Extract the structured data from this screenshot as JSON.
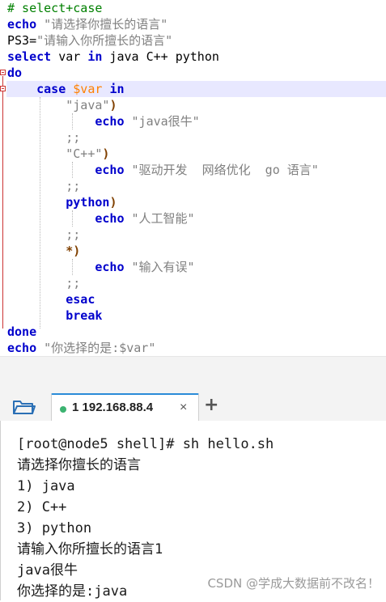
{
  "editor": {
    "lines": [
      [
        {
          "c": "cm",
          "t": "# select+case"
        }
      ],
      [
        {
          "c": "kw",
          "t": "echo"
        },
        {
          "c": "plain",
          "t": " "
        },
        {
          "c": "str",
          "t": "\"请选择你擅长的语言\""
        }
      ],
      [
        {
          "c": "plain",
          "t": "PS3="
        },
        {
          "c": "str",
          "t": "\"请输入你所擅长的语言\""
        }
      ],
      [
        {
          "c": "kw",
          "t": "select"
        },
        {
          "c": "plain",
          "t": " var "
        },
        {
          "c": "kw",
          "t": "in"
        },
        {
          "c": "plain",
          "t": " java C++ python"
        }
      ],
      [
        {
          "c": "kw",
          "t": "do"
        }
      ],
      [
        {
          "c": "plain",
          "t": "    "
        },
        {
          "c": "kw",
          "t": "case"
        },
        {
          "c": "plain",
          "t": " "
        },
        {
          "c": "var",
          "t": "$var"
        },
        {
          "c": "plain",
          "t": " "
        },
        {
          "c": "kw",
          "t": "in"
        }
      ],
      [
        {
          "c": "plain",
          "t": "        "
        },
        {
          "c": "str",
          "t": "\"java\""
        },
        {
          "c": "op",
          "t": ")"
        }
      ],
      [
        {
          "c": "plain",
          "t": "            "
        },
        {
          "c": "kw",
          "t": "echo"
        },
        {
          "c": "plain",
          "t": " "
        },
        {
          "c": "str",
          "t": "\"java很牛\""
        }
      ],
      [
        {
          "c": "plain",
          "t": "        "
        },
        {
          "c": "str",
          "t": ";;"
        }
      ],
      [
        {
          "c": "plain",
          "t": "        "
        },
        {
          "c": "str",
          "t": "\"C++\""
        },
        {
          "c": "op",
          "t": ")"
        }
      ],
      [
        {
          "c": "plain",
          "t": "            "
        },
        {
          "c": "kw",
          "t": "echo"
        },
        {
          "c": "plain",
          "t": " "
        },
        {
          "c": "str",
          "t": "\"驱动开发  网络优化  go 语言\""
        }
      ],
      [
        {
          "c": "plain",
          "t": "        "
        },
        {
          "c": "str",
          "t": ";;"
        }
      ],
      [
        {
          "c": "plain",
          "t": "        "
        },
        {
          "c": "kw",
          "t": "python"
        },
        {
          "c": "op",
          "t": ")"
        }
      ],
      [
        {
          "c": "plain",
          "t": "            "
        },
        {
          "c": "kw",
          "t": "echo"
        },
        {
          "c": "plain",
          "t": " "
        },
        {
          "c": "str",
          "t": "\"人工智能\""
        }
      ],
      [
        {
          "c": "plain",
          "t": "        "
        },
        {
          "c": "str",
          "t": ";;"
        }
      ],
      [
        {
          "c": "plain",
          "t": "        "
        },
        {
          "c": "op",
          "t": "*)"
        }
      ],
      [
        {
          "c": "plain",
          "t": "            "
        },
        {
          "c": "kw",
          "t": "echo"
        },
        {
          "c": "plain",
          "t": " "
        },
        {
          "c": "str",
          "t": "\"输入有误\""
        }
      ],
      [
        {
          "c": "plain",
          "t": "        "
        },
        {
          "c": "str",
          "t": ";;"
        }
      ],
      [
        {
          "c": "plain",
          "t": "        "
        },
        {
          "c": "kw",
          "t": "esac"
        }
      ],
      [
        {
          "c": "plain",
          "t": "        "
        },
        {
          "c": "kw",
          "t": "break"
        }
      ],
      [
        {
          "c": "kw",
          "t": "done"
        }
      ],
      [
        {
          "c": "kw",
          "t": "echo"
        },
        {
          "c": "plain",
          "t": " "
        },
        {
          "c": "str",
          "t": "\"你选择的是:$var\""
        }
      ]
    ],
    "highlighted_line": 5,
    "colors": {
      "keyword": "#0000cc",
      "string": "#808080",
      "comment": "#008000",
      "variable": "#ff8000",
      "fold_marker": "#cc3333",
      "current_line": "#e8e8ff"
    }
  },
  "tabbar": {
    "folder_icon": "folder-icon",
    "tab_number": "1",
    "tab_host": "192.168.88.4",
    "tab_close": "×",
    "add_tab": "+",
    "connected_color": "#3cb371"
  },
  "terminal": {
    "lines": [
      "[root@node5 shell]# sh hello.sh",
      "请选择你擅长的语言",
      "1) java",
      "2) C++",
      "3) python",
      "请输入你所擅长的语言1",
      "java很牛",
      "你选择的是:java"
    ],
    "watermark": "CSDN @学成大数据前不改名！"
  }
}
